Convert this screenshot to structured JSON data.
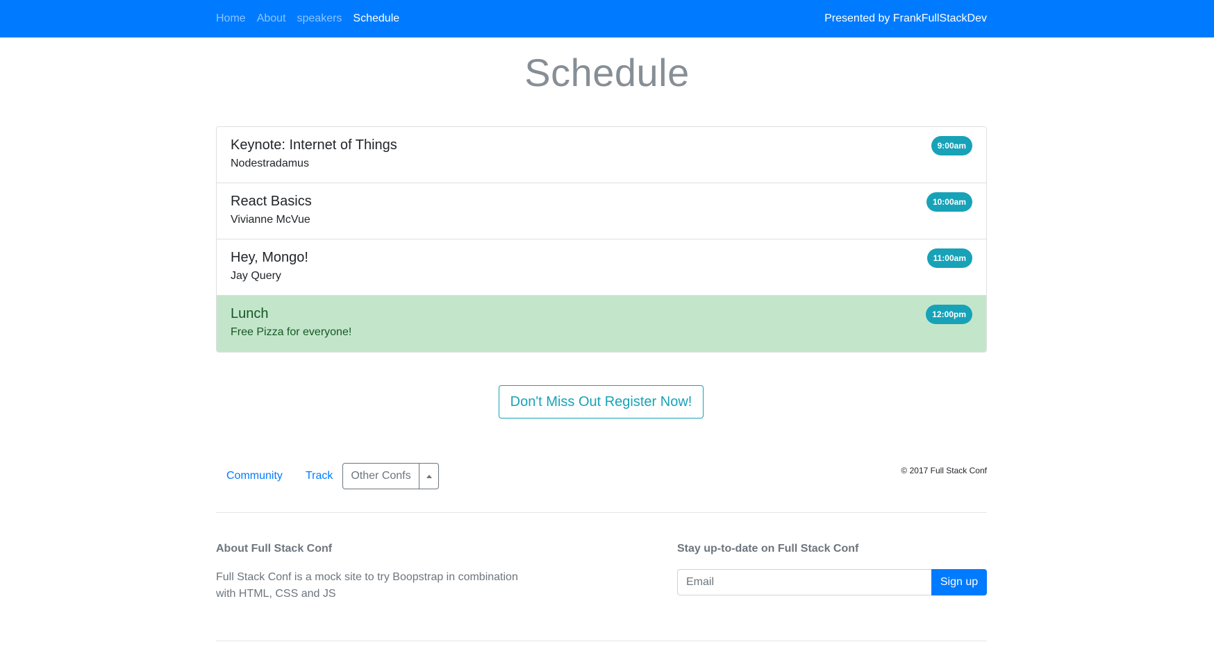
{
  "nav": {
    "links": [
      {
        "label": "Home",
        "active": false
      },
      {
        "label": "About",
        "active": false
      },
      {
        "label": "speakers",
        "active": false
      },
      {
        "label": "Schedule",
        "active": true
      }
    ],
    "presented_by": "Presented by FrankFullStackDev"
  },
  "page_title": "Schedule",
  "schedule": [
    {
      "title": "Keynote: Internet of Things",
      "speaker": "Nodestradamus",
      "time": "9:00am"
    },
    {
      "title": "React Basics",
      "speaker": "Vivianne McVue",
      "time": "10:00am"
    },
    {
      "title": "Hey, Mongo!",
      "speaker": "Jay Query",
      "time": "11:00am"
    },
    {
      "title": "Lunch",
      "speaker": "Free Pizza for everyone!",
      "time": "12:00pm"
    }
  ],
  "register_button": "Don't Miss Out Register Now!",
  "footer_nav": {
    "community": "Community",
    "track": "Track",
    "dropdown_label": "Other Confs",
    "copyright": "© 2017 Full Stack Conf"
  },
  "about": {
    "title": "About Full Stack Conf",
    "text": "Full Stack Conf is a mock site to try Boopstrap in combination with HTML, CSS and JS"
  },
  "newsletter": {
    "title": "Stay up-to-date on Full Stack Conf",
    "placeholder": "Email",
    "button": "Sign up"
  },
  "colors": {
    "primary": "#007bff",
    "info": "#17a2b8",
    "success_bg": "#c3e6cb",
    "muted": "#6c757d"
  },
  "icons": {
    "dropdown_caret": "caret-up-icon"
  }
}
